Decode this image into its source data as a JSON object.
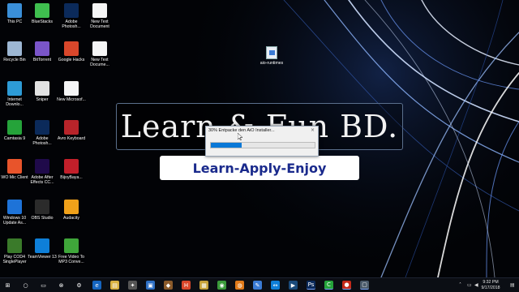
{
  "desktop": {
    "icons": [
      {
        "label": "This PC",
        "icon": "computer-icon",
        "color": "#3a8fd8"
      },
      {
        "label": "BlueStacks",
        "icon": "bluestacks-icon",
        "color": "#3fbf4f"
      },
      {
        "label": "Adobe Photosh...",
        "icon": "photoshop-icon",
        "color": "#0b2a5a"
      },
      {
        "label": "New Text Document",
        "icon": "text-file-icon",
        "color": "#f5f5f5"
      },
      {
        "label": "Recycle Bin",
        "icon": "recycle-bin-icon",
        "color": "#9db7d3"
      },
      {
        "label": "BitTorrent",
        "icon": "bittorrent-icon",
        "color": "#7a55c9"
      },
      {
        "label": "Google Hacks",
        "icon": "google-hacks-icon",
        "color": "#d9472b"
      },
      {
        "label": "New Text Docume...",
        "icon": "text-file-icon",
        "color": "#f5f5f5"
      },
      {
        "label": "Internet Downlo...",
        "icon": "idm-icon",
        "color": "#2d9bd6"
      },
      {
        "label": "Sniper",
        "icon": "sniper-icon",
        "color": "#e2e2e2"
      },
      {
        "label": "New Microsof...",
        "icon": "word-file-icon",
        "color": "#f5f5f5"
      },
      {
        "label": "Camtasia 9",
        "icon": "camtasia-icon",
        "color": "#25a33a"
      },
      {
        "label": "Adobe Photosh...",
        "icon": "photoshop-icon",
        "color": "#0b2a5a"
      },
      {
        "label": "Avro Keyboard",
        "icon": "avro-keyboard-icon",
        "color": "#b8242a"
      },
      {
        "label": "WO Mic Client",
        "icon": "microphone-icon",
        "color": "#e8542b"
      },
      {
        "label": "Adobe After Effects CC...",
        "icon": "after-effects-icon",
        "color": "#1f0a4a"
      },
      {
        "label": "BijoyBaya...",
        "icon": "bijoy-icon",
        "color": "#c21f2a"
      },
      {
        "label": "Windows 10 Update As...",
        "icon": "windows-update-icon",
        "color": "#1e73d8"
      },
      {
        "label": "OBS Studio",
        "icon": "obs-icon",
        "color": "#2b2b2b"
      },
      {
        "label": "Audacity",
        "icon": "audacity-icon",
        "color": "#f0a11a"
      },
      {
        "label": "Play COD4 SinglePlayer",
        "icon": "cod4-icon",
        "color": "#3a7a2a"
      },
      {
        "label": "TeamViewer 13",
        "icon": "teamviewer-icon",
        "color": "#0e7fd8"
      },
      {
        "label": "Free Video To MP3 Conve...",
        "icon": "video-to-mp3-icon",
        "color": "#3fa63a"
      }
    ],
    "file": {
      "label": "aio-runtimes",
      "icon": "installer-file-icon"
    }
  },
  "banner": {
    "title": "Learn & Fun BD.",
    "tagline": "Learn-Apply-Enjoy"
  },
  "dialog": {
    "title": "30% Entpacke den AiO Installer...",
    "close_glyph": "×",
    "progress_percent": 30,
    "accent_color": "#0a78d7"
  },
  "taskbar": {
    "items": [
      {
        "icon": "start-windows-icon",
        "glyph": "⊞",
        "color": "#0b0e14"
      },
      {
        "icon": "search-icon",
        "glyph": "○",
        "color": "#0b0e14"
      },
      {
        "icon": "task-view-icon",
        "glyph": "▭",
        "color": "#0b0e14"
      },
      {
        "icon": "xbox-icon",
        "glyph": "⊗",
        "color": "#0b0e14"
      },
      {
        "icon": "settings-icon",
        "glyph": "⚙",
        "color": "#0b0e14"
      },
      {
        "icon": "edge-icon",
        "glyph": "e",
        "color": "#1565c0"
      },
      {
        "icon": "file-explorer-icon",
        "glyph": "▤",
        "color": "#d8b242"
      },
      {
        "icon": "games-icon",
        "glyph": "✦",
        "color": "#555555"
      },
      {
        "icon": "store-icon",
        "glyph": "▣",
        "color": "#2d6fc4"
      },
      {
        "icon": "game-app-icon",
        "glyph": "◆",
        "color": "#8a5a2a"
      },
      {
        "icon": "google-hacks-taskbar-icon",
        "glyph": "H",
        "color": "#d9472b"
      },
      {
        "icon": "photo-app-icon",
        "glyph": "▦",
        "color": "#c7a23a"
      },
      {
        "icon": "chrome-icon",
        "glyph": "◉",
        "color": "#3a9a3a"
      },
      {
        "icon": "firefox-icon",
        "glyph": "◍",
        "color": "#e07a1a"
      },
      {
        "icon": "paint-icon",
        "glyph": "✎",
        "color": "#3a7bd5"
      },
      {
        "icon": "teamviewer-taskbar-icon",
        "glyph": "↔",
        "color": "#0e7fd8"
      },
      {
        "icon": "media-app-icon",
        "glyph": "▶",
        "color": "#1a4a7a"
      },
      {
        "icon": "photoshop-taskbar-icon",
        "glyph": "Ps",
        "color": "#0b2a5a"
      },
      {
        "icon": "camtasia-taskbar-icon",
        "glyph": "C",
        "color": "#25a33a"
      },
      {
        "icon": "record-icon",
        "glyph": "●",
        "color": "#c42a1a"
      },
      {
        "icon": "installer-taskbar-icon",
        "glyph": "▢",
        "color": "#4a5a6a"
      }
    ],
    "clock_time": "9:32 PM",
    "clock_date": "9/17/2018"
  }
}
